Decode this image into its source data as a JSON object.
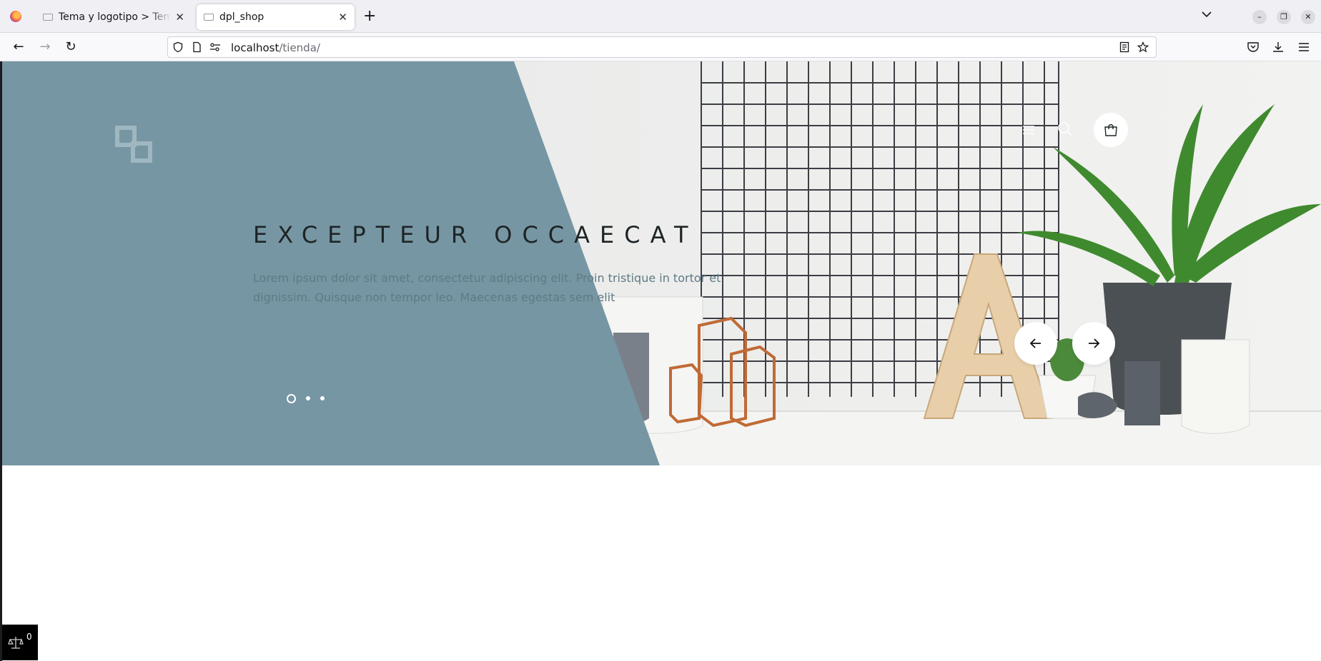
{
  "browser": {
    "tabs": [
      {
        "title": "Tema y logotipo > Tema - WordPress",
        "active": false
      },
      {
        "title": "dpl_shop",
        "active": true
      }
    ],
    "url_host": "localhost",
    "url_path": "/tienda/"
  },
  "hero": {
    "headline": "EXCEPTEUR OCCAECAT",
    "subtitle": "Lorem ipsum dolor sit amet, consectetur adipiscing elit. Proin tristique in tortor et dignissim. Quisque non tempor leo. Maecenas egestas sem elit",
    "slide_count": 3,
    "active_slide": 1,
    "overlay_color": "#7696a3"
  },
  "compare": {
    "count": "0"
  },
  "icons": [
    "firefox-icon",
    "page-icon",
    "close-icon",
    "plus-icon",
    "chevron-down-icon",
    "minimize-icon",
    "restore-icon",
    "back-icon",
    "forward-icon",
    "reload-icon",
    "shield-icon",
    "document-icon",
    "permissions-icon",
    "reader-icon",
    "star-icon",
    "pocket-icon",
    "download-icon",
    "menu-icon",
    "logo-icon",
    "search-icon",
    "cart-icon",
    "arrow-left-icon",
    "arrow-right-icon",
    "scale-icon"
  ]
}
